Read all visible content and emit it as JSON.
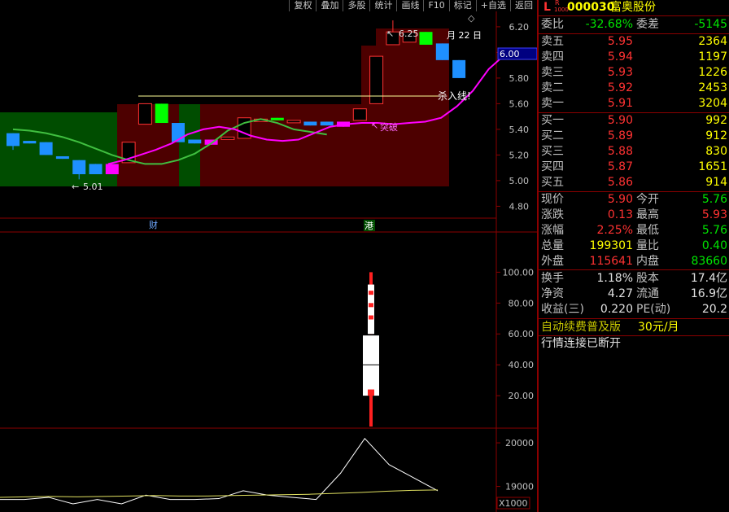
{
  "toolbar": {
    "items": [
      "复权",
      "叠加",
      "多股",
      "统计",
      "画线",
      "F10",
      "标记",
      "+自选",
      "返回"
    ]
  },
  "chart": {
    "date_label": "月 22 日",
    "current_price_tag": "6.00",
    "high_annotation": "6.25",
    "low_annotation": "5.01",
    "kill_line_label": "杀入线!",
    "breakout_label": "突破",
    "marker_cai": "财",
    "marker_gang": "港",
    "volume_unit": "X1000",
    "price_axis": [
      "6.20",
      "6.00",
      "5.80",
      "5.60",
      "5.40",
      "5.20",
      "5.00",
      "4.80"
    ],
    "indicator_axis": [
      "100.00",
      "80.00",
      "60.00",
      "40.00",
      "20.00"
    ],
    "volume_axis": [
      "20000",
      "19000"
    ]
  },
  "chart_data": {
    "type": "candlestick",
    "price_ylim": [
      4.72,
      6.32
    ],
    "candles": [
      {
        "o": 5.27,
        "c": 5.37,
        "h": 5.37,
        "l": 5.24,
        "color": "blue"
      },
      {
        "o": 5.31,
        "c": 5.29,
        "h": 5.31,
        "l": 5.29,
        "color": "blue"
      },
      {
        "o": 5.3,
        "c": 5.2,
        "h": 5.3,
        "l": 5.2,
        "color": "blue"
      },
      {
        "o": 5.19,
        "c": 5.17,
        "h": 5.19,
        "l": 5.17,
        "color": "blue"
      },
      {
        "o": 5.16,
        "c": 5.05,
        "h": 5.16,
        "l": 5.01,
        "color": "blue"
      },
      {
        "o": 5.13,
        "c": 5.05,
        "h": 5.13,
        "l": 5.05,
        "color": "blue"
      },
      {
        "o": 5.05,
        "c": 5.13,
        "h": 5.13,
        "l": 5.05,
        "color": "magenta"
      },
      {
        "o": 5.14,
        "c": 5.3,
        "h": 5.3,
        "l": 5.14,
        "color": "hollow"
      },
      {
        "o": 5.44,
        "c": 5.6,
        "h": 5.6,
        "l": 5.44,
        "color": "hollow"
      },
      {
        "o": 5.45,
        "c": 5.6,
        "h": 5.6,
        "l": 5.45,
        "color": "green"
      },
      {
        "o": 5.45,
        "c": 5.3,
        "h": 5.45,
        "l": 5.3,
        "color": "blue"
      },
      {
        "o": 5.32,
        "c": 5.29,
        "h": 5.32,
        "l": 5.29,
        "color": "blue"
      },
      {
        "o": 5.32,
        "c": 5.28,
        "h": 5.32,
        "l": 5.28,
        "color": "magenta"
      },
      {
        "o": 5.33,
        "c": 5.34,
        "h": 5.34,
        "l": 5.33,
        "color": "hollow"
      },
      {
        "o": 5.33,
        "c": 5.49,
        "h": 5.49,
        "l": 5.33,
        "color": "hollow"
      },
      {
        "o": 5.47,
        "c": 5.48,
        "h": 5.48,
        "l": 5.47,
        "color": "hollow"
      },
      {
        "o": 5.49,
        "c": 5.47,
        "h": 5.49,
        "l": 5.47,
        "color": "green"
      },
      {
        "o": 5.46,
        "c": 5.47,
        "h": 5.47,
        "l": 5.46,
        "color": "hollow"
      },
      {
        "o": 5.46,
        "c": 5.43,
        "h": 5.46,
        "l": 5.43,
        "color": "blue"
      },
      {
        "o": 5.46,
        "c": 5.43,
        "h": 5.46,
        "l": 5.43,
        "color": "blue"
      },
      {
        "o": 5.46,
        "c": 5.42,
        "h": 5.46,
        "l": 5.42,
        "color": "magenta"
      },
      {
        "o": 5.47,
        "c": 5.56,
        "h": 5.56,
        "l": 5.47,
        "color": "hollow"
      },
      {
        "o": 5.6,
        "c": 5.97,
        "h": 5.97,
        "l": 5.6,
        "color": "hollow"
      },
      {
        "o": 6.06,
        "c": 6.16,
        "h": 6.25,
        "l": 6.06,
        "color": "hollow"
      },
      {
        "o": 6.08,
        "c": 6.16,
        "h": 6.16,
        "l": 6.08,
        "color": "hollow"
      },
      {
        "o": 6.16,
        "c": 6.06,
        "h": 6.16,
        "l": 6.06,
        "color": "green"
      },
      {
        "o": 6.07,
        "c": 5.94,
        "h": 6.07,
        "l": 5.94,
        "color": "blue"
      },
      {
        "o": 5.94,
        "c": 5.8,
        "h": 5.94,
        "l": 5.8,
        "color": "blue"
      }
    ],
    "ma_green": [
      5.4,
      5.39,
      5.37,
      5.34,
      5.3,
      5.25,
      5.2,
      5.16,
      5.13,
      5.13,
      5.16,
      5.21,
      5.29,
      5.39,
      5.45,
      5.48,
      5.45,
      5.4,
      5.38,
      5.36
    ],
    "ma_magenta": [
      5.13,
      5.16,
      5.2,
      5.24,
      5.29,
      5.36,
      5.4,
      5.42,
      5.4,
      5.35,
      5.32,
      5.31,
      5.32,
      5.37,
      5.42,
      5.44,
      5.45,
      5.45,
      5.44,
      5.45,
      5.46,
      5.49,
      5.58,
      5.7,
      5.87,
      5.98,
      6.03,
      6.0,
      5.97
    ],
    "kill_line": 5.66,
    "indicator": {
      "center": 40,
      "body": [
        20,
        60
      ],
      "upper": [
        60,
        100
      ],
      "lower": [
        5,
        20
      ],
      "ylim": [
        0,
        125
      ]
    },
    "volume_line": [
      18700,
      18700,
      18750,
      18600,
      18700,
      18600,
      18800,
      18700,
      18700,
      18720,
      18900,
      18800,
      18750,
      18700,
      19300,
      20100,
      19500,
      19200,
      18900
    ],
    "volume_avg": [
      18750,
      18760,
      18770,
      18760,
      18770,
      18780,
      18790,
      18780,
      18780,
      18790,
      18800,
      18810,
      18820,
      18840,
      18860,
      18890,
      18910,
      18920
    ],
    "volume_ylim": [
      18450,
      20300
    ]
  },
  "quote": {
    "stock_code": "000030",
    "stock_name": "富奥股份",
    "title_prefix": "L",
    "title_sup": "R",
    "title_sub": "1000",
    "weibi_label": "委比",
    "weibi_value": "-32.68%",
    "weicha_label": "委差",
    "weicha_value": "-5145",
    "sells": [
      {
        "label": "卖五",
        "price": "5.95",
        "vol": "2364"
      },
      {
        "label": "卖四",
        "price": "5.94",
        "vol": "1197"
      },
      {
        "label": "卖三",
        "price": "5.93",
        "vol": "1226"
      },
      {
        "label": "卖二",
        "price": "5.92",
        "vol": "2453"
      },
      {
        "label": "卖一",
        "price": "5.91",
        "vol": "3204"
      }
    ],
    "buys": [
      {
        "label": "买一",
        "price": "5.90",
        "vol": "992"
      },
      {
        "label": "买二",
        "price": "5.89",
        "vol": "912"
      },
      {
        "label": "买三",
        "price": "5.88",
        "vol": "830"
      },
      {
        "label": "买四",
        "price": "5.87",
        "vol": "1651"
      },
      {
        "label": "买五",
        "price": "5.86",
        "vol": "914"
      }
    ],
    "stats1": [
      {
        "l1": "现价",
        "v1": "5.90",
        "l2": "今开",
        "v2": "5.76"
      },
      {
        "l1": "涨跌",
        "v1": "0.13",
        "l2": "最高",
        "v2": "5.93"
      },
      {
        "l1": "涨幅",
        "v1": "2.25%",
        "l2": "最低",
        "v2": "5.76"
      },
      {
        "l1": "总量",
        "v1": "199301",
        "l2": "量比",
        "v2": "0.40"
      },
      {
        "l1": "外盘",
        "v1": "115641",
        "l2": "内盘",
        "v2": "83660"
      }
    ],
    "stats2": [
      {
        "l1": "换手",
        "v1": "1.18%",
        "l2": "股本",
        "v2": "17.4亿"
      },
      {
        "l1": "净资",
        "v1": "4.27",
        "l2": "流通",
        "v2": "16.9亿"
      },
      {
        "l1": "收益(三)",
        "v1": "0.220",
        "l2": "PE(动)",
        "v2": "20.2"
      }
    ],
    "promo_text": "自动续费普及版",
    "promo_price": "30元/月",
    "status_text": "行情连接已断开"
  },
  "colors": {
    "up": "#ff3232",
    "down_green": "#00e600",
    "label_yellow": "#c8c800",
    "border": "#8b0000"
  }
}
